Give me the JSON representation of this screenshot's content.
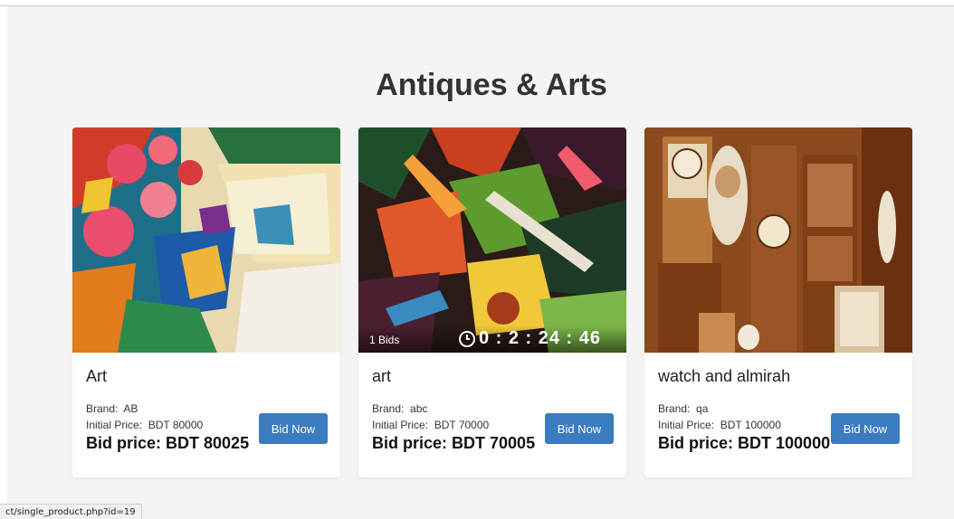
{
  "section": {
    "title": "Antiques & Arts"
  },
  "products": [
    {
      "title": "Art",
      "brand_label": "Brand:",
      "brand": "AB",
      "initial_label": "Initial Price:",
      "initial_price": "BDT 80000",
      "bid_label": "Bid price:",
      "bid_price": "BDT 80025",
      "button": "Bid Now"
    },
    {
      "title": "art",
      "brand_label": "Brand:",
      "brand": "abc",
      "initial_label": "Initial Price:",
      "initial_price": "BDT 70000",
      "bid_label": "Bid price:",
      "bid_price": "BDT 70005",
      "button": "Bid Now",
      "bids": "1 Bids",
      "timer": "0 : 2 : 24 : 46"
    },
    {
      "title": "watch and almirah",
      "brand_label": "Brand:",
      "brand": "qa",
      "initial_label": "Initial Price:",
      "initial_price": "BDT 100000",
      "bid_label": "Bid price:",
      "bid_price": "BDT 100000",
      "button": "Bid Now"
    }
  ],
  "status_bar": {
    "url": "ct/single_product.php?id=19"
  },
  "colors": {
    "button": "#3b7bbf",
    "background": "#f4f4f4"
  }
}
